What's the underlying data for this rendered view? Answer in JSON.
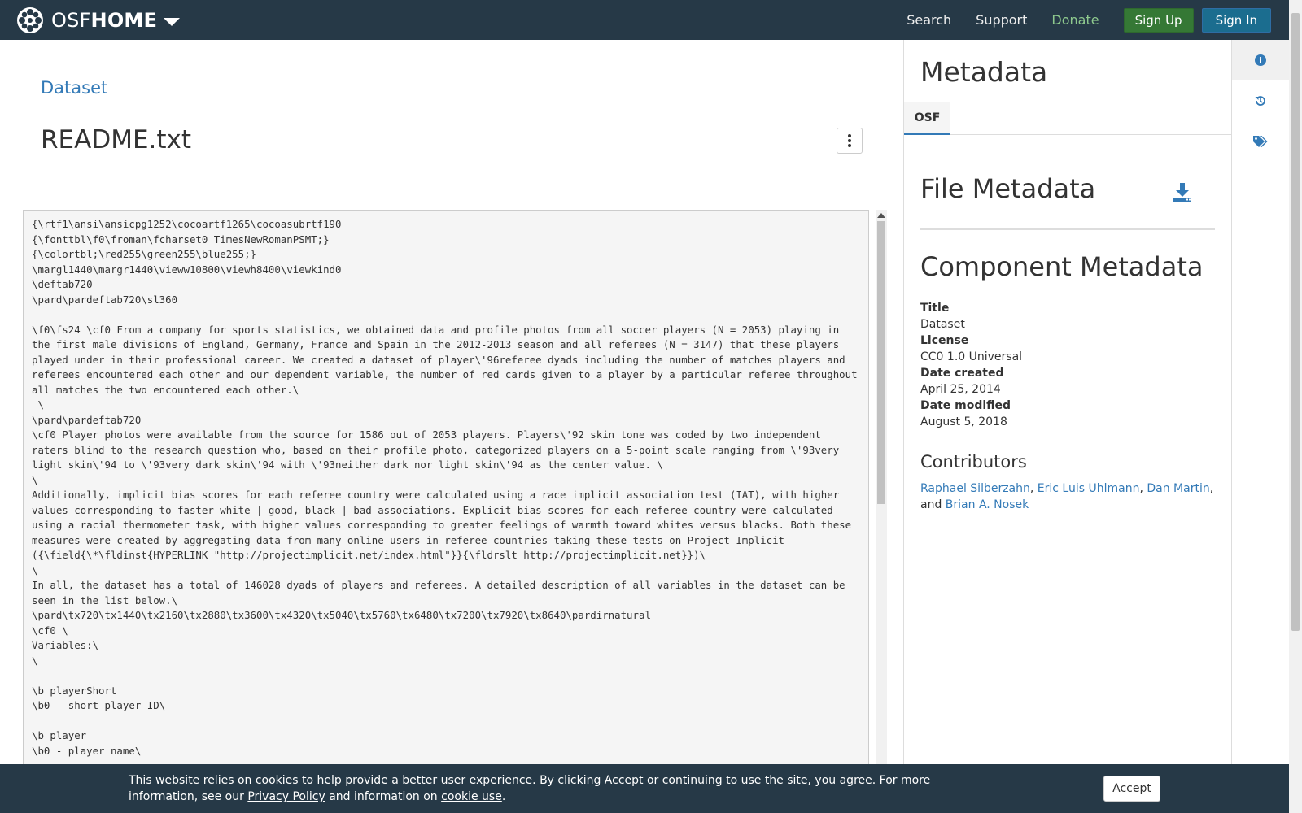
{
  "navbar": {
    "brand_light": "OSF",
    "brand_bold": "HOME",
    "links": [
      "Search",
      "Support",
      "Donate"
    ],
    "signup_label": "Sign Up",
    "signin_label": "Sign In"
  },
  "main": {
    "breadcrumb": "Dataset",
    "file_title": "README.txt",
    "file_content": "{\\rtf1\\ansi\\ansicpg1252\\cocoartf1265\\cocoasubrtf190\n{\\fonttbl\\f0\\froman\\fcharset0 TimesNewRomanPSMT;}\n{\\colortbl;\\red255\\green255\\blue255;}\n\\margl1440\\margr1440\\vieww10800\\viewh8400\\viewkind0\n\\deftab720\n\\pard\\pardeftab720\\sl360\n\n\\f0\\fs24 \\cf0 From a company for sports statistics, we obtained data and profile photos from all soccer players (N = 2053) playing in the first male divisions of England, Germany, France and Spain in the 2012-2013 season and all referees (N = 3147) that these players played under in their professional career. We created a dataset of player\\'96referee dyads including the number of matches players and referees encountered each other and our dependent variable, the number of red cards given to a player by a particular referee throughout all matches the two encountered each other.\\\n \\\n\\pard\\pardeftab720\n\\cf0 Player photos were available from the source for 1586 out of 2053 players. Players\\'92 skin tone was coded by two independent raters blind to the research question who, based on their profile photo, categorized players on a 5-point scale ranging from \\'93very light skin\\'94 to \\'93very dark skin\\'94 with \\'93neither dark nor light skin\\'94 as the center value. \\\n\\\nAdditionally, implicit bias scores for each referee country were calculated using a race implicit association test (IAT), with higher values corresponding to faster white | good, black | bad associations. Explicit bias scores for each referee country were calculated using a racial thermometer task, with higher values corresponding to greater feelings of warmth toward whites versus blacks. Both these measures were created by aggregating data from many online users in referee countries taking these tests on Project Implicit ({\\field{\\*\\fldinst{HYPERLINK \"http://projectimplicit.net/index.html\"}}{\\fldrslt http://projectimplicit.net}})\\\n\\\nIn all, the dataset has a total of 146028 dyads of players and referees. A detailed description of all variables in the dataset can be seen in the list below.\\\n\\pard\\tx720\\tx1440\\tx2160\\tx2880\\tx3600\\tx4320\\tx5040\\tx5760\\tx6480\\tx7200\\tx7920\\tx8640\\pardirnatural\n\\cf0 \\\nVariables:\\\n\\\n\n\\b playerShort\n\\b0 - short player ID\\\n\n\\b player\n\\b0 - player name\\"
  },
  "panel": {
    "title": "Metadata",
    "tab_label": "OSF",
    "file_meta_title": "File Metadata",
    "component_meta_title": "Component Metadata",
    "fields": [
      {
        "key": "Title",
        "value": "Dataset"
      },
      {
        "key": "License",
        "value": "CC0 1.0 Universal"
      },
      {
        "key": "Date created",
        "value": "April 25, 2014"
      },
      {
        "key": "Date modified",
        "value": "August 5, 2018"
      }
    ],
    "contributors_title": "Contributors",
    "contributors": [
      "Raphael Silberzahn",
      "Eric Luis Uhlmann",
      "Dan Martin",
      "Brian A. Nosek"
    ],
    "contributors_sep1": ", ",
    "contributors_sep2": ", ",
    "contributors_sep3": ",",
    "contributors_and": "and "
  },
  "rail": {
    "icons": [
      "info-icon",
      "history-icon",
      "tags-icon"
    ],
    "accent": "#337ab7"
  },
  "cookie": {
    "text_before": "This website relies on cookies to help provide a better user experience. By clicking Accept or continuing to use the site, you agree. For more information, see our ",
    "privacy_link": "Privacy Policy",
    "text_middle": " and information on ",
    "cookie_link": "cookie use",
    "text_after": ".",
    "accept_label": "Accept"
  },
  "colors": {
    "navbar_bg": "#263947",
    "signup_bg": "#357835",
    "signin_bg": "#1b6d8f",
    "link": "#337ab7",
    "donate": "#8ec98e"
  }
}
